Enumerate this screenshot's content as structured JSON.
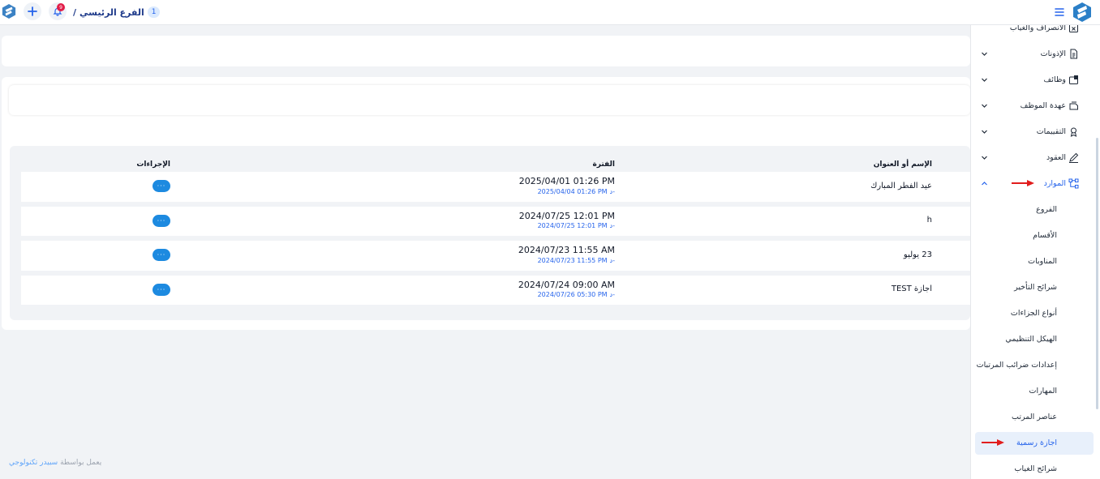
{
  "topbar": {
    "breadcrumb_num": "1",
    "breadcrumb_label": "الفرع الرئيسي",
    "breadcrumb_sep": "/",
    "notifications_count": "9"
  },
  "table": {
    "headers": {
      "name": "الإسم أو العنوان",
      "period": "الفترة",
      "actions": "الإجراءات"
    },
    "end_prefix": "د‐",
    "action_label": "···",
    "rows": [
      {
        "name": "عيد الفطر المبارك",
        "start": "2025/04/01 01:26 PM",
        "end": "2025/04/04 01:26 PM"
      },
      {
        "name": "h",
        "start": "2024/07/25 12:01 PM",
        "end": "2024/07/25 12:01 PM"
      },
      {
        "name": "23 يوليو",
        "start": "2024/07/23 11:55 AM",
        "end": "2024/07/23 11:55 PM"
      },
      {
        "name": "اجازة TEST",
        "start": "2024/07/24 09:00 AM",
        "end": "2024/07/26 05:30 PM"
      }
    ]
  },
  "footer": {
    "text": "يعمل بواسطة",
    "brand": "سبيدر تكنولوجي"
  },
  "sidebar": {
    "items": [
      {
        "label": "الانصراف والغياب",
        "icon": "calendar-x-icon"
      },
      {
        "label": "الإذونات",
        "icon": "document-icon",
        "chevron": "down"
      },
      {
        "label": "وظائف",
        "icon": "jobs-icon",
        "chevron": "down"
      },
      {
        "label": "عهدة الموظف",
        "icon": "custody-icon",
        "chevron": "down"
      },
      {
        "label": "التقييمات",
        "icon": "rating-icon",
        "chevron": "down"
      },
      {
        "label": "العقود",
        "icon": "pen-icon",
        "chevron": "down"
      },
      {
        "label": "الموارد",
        "icon": "hierarchy-icon",
        "chevron": "up"
      }
    ],
    "subitems": [
      "الفروع",
      "الأقسام",
      "المناوبات",
      "شرائح التأخير",
      "أنواع الجزاءات",
      "الهيكل التنظيمي",
      "إعدادات ضرائب المرتبات",
      "المهارات",
      "عناصر المرتب",
      "اجازة رسمية",
      "شرائح الغياب"
    ]
  },
  "colors": {
    "accent": "#1d8ae0",
    "brand": "#1e3a8a",
    "badge": "#e11d48",
    "arrow": "#e11d1d"
  }
}
